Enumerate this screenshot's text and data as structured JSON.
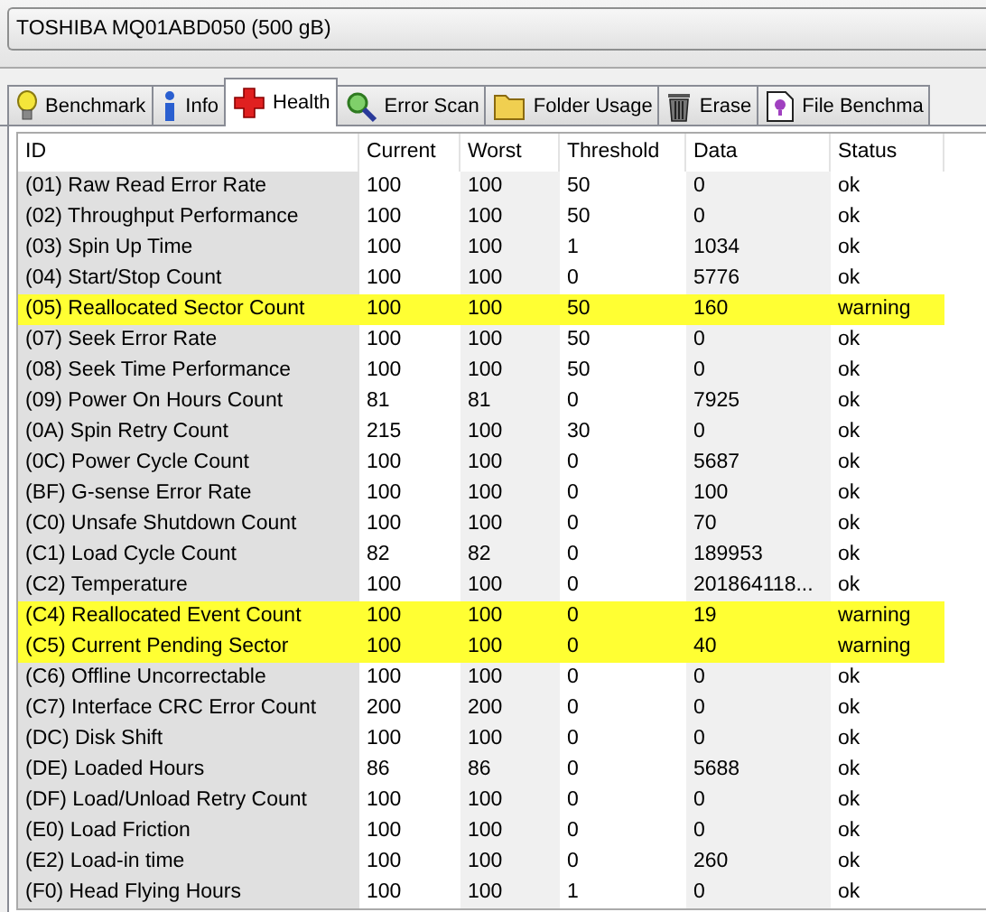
{
  "drive_select": {
    "value": "TOSHIBA MQ01ABD050 (500 gB)"
  },
  "tabs": [
    {
      "label": "Benchmark",
      "selected": false
    },
    {
      "label": "Info",
      "selected": false
    },
    {
      "label": "Health",
      "selected": true
    },
    {
      "label": "Error Scan",
      "selected": false
    },
    {
      "label": "Folder Usage",
      "selected": false
    },
    {
      "label": "Erase",
      "selected": false
    },
    {
      "label": "File Benchma",
      "selected": false
    }
  ],
  "table": {
    "columns": [
      "ID",
      "Current",
      "Worst",
      "Threshold",
      "Data",
      "Status"
    ],
    "rows": [
      {
        "cells": [
          "(01) Raw Read Error Rate",
          "100",
          "100",
          "50",
          "0",
          "ok"
        ],
        "highlighted": false
      },
      {
        "cells": [
          "(02) Throughput Performance",
          "100",
          "100",
          "50",
          "0",
          "ok"
        ],
        "highlighted": false
      },
      {
        "cells": [
          "(03) Spin Up Time",
          "100",
          "100",
          "1",
          "1034",
          "ok"
        ],
        "highlighted": false
      },
      {
        "cells": [
          "(04) Start/Stop Count",
          "100",
          "100",
          "0",
          "5776",
          "ok"
        ],
        "highlighted": false
      },
      {
        "cells": [
          "(05) Reallocated Sector Count",
          "100",
          "100",
          "50",
          "160",
          "warning"
        ],
        "highlighted": true
      },
      {
        "cells": [
          "(07) Seek Error Rate",
          "100",
          "100",
          "50",
          "0",
          "ok"
        ],
        "highlighted": false
      },
      {
        "cells": [
          "(08) Seek Time Performance",
          "100",
          "100",
          "50",
          "0",
          "ok"
        ],
        "highlighted": false
      },
      {
        "cells": [
          "(09) Power On Hours Count",
          "81",
          "81",
          "0",
          "7925",
          "ok"
        ],
        "highlighted": false
      },
      {
        "cells": [
          "(0A) Spin Retry Count",
          "215",
          "100",
          "30",
          "0",
          "ok"
        ],
        "highlighted": false
      },
      {
        "cells": [
          "(0C) Power Cycle Count",
          "100",
          "100",
          "0",
          "5687",
          "ok"
        ],
        "highlighted": false
      },
      {
        "cells": [
          "(BF) G-sense Error Rate",
          "100",
          "100",
          "0",
          "100",
          "ok"
        ],
        "highlighted": false
      },
      {
        "cells": [
          "(C0) Unsafe Shutdown Count",
          "100",
          "100",
          "0",
          "70",
          "ok"
        ],
        "highlighted": false
      },
      {
        "cells": [
          "(C1) Load Cycle Count",
          "82",
          "82",
          "0",
          "189953",
          "ok"
        ],
        "highlighted": false
      },
      {
        "cells": [
          "(C2) Temperature",
          "100",
          "100",
          "0",
          "201864118...",
          "ok"
        ],
        "highlighted": false
      },
      {
        "cells": [
          "(C4) Reallocated Event Count",
          "100",
          "100",
          "0",
          "19",
          "warning"
        ],
        "highlighted": true
      },
      {
        "cells": [
          "(C5) Current Pending Sector",
          "100",
          "100",
          "0",
          "40",
          "warning"
        ],
        "highlighted": true
      },
      {
        "cells": [
          "(C6) Offline Uncorrectable",
          "100",
          "100",
          "0",
          "0",
          "ok"
        ],
        "highlighted": false
      },
      {
        "cells": [
          "(C7) Interface CRC Error Count",
          "200",
          "200",
          "0",
          "0",
          "ok"
        ],
        "highlighted": false
      },
      {
        "cells": [
          "(DC) Disk Shift",
          "100",
          "100",
          "0",
          "0",
          "ok"
        ],
        "highlighted": false
      },
      {
        "cells": [
          "(DE) Loaded Hours",
          "86",
          "86",
          "0",
          "5688",
          "ok"
        ],
        "highlighted": false
      },
      {
        "cells": [
          "(DF) Load/Unload Retry Count",
          "100",
          "100",
          "0",
          "0",
          "ok"
        ],
        "highlighted": false
      },
      {
        "cells": [
          "(E0) Load Friction",
          "100",
          "100",
          "0",
          "0",
          "ok"
        ],
        "highlighted": false
      },
      {
        "cells": [
          "(E2) Load-in time",
          "100",
          "100",
          "0",
          "260",
          "ok"
        ],
        "highlighted": false
      },
      {
        "cells": [
          "(F0) Head Flying Hours",
          "100",
          "100",
          "1",
          "0",
          "ok"
        ],
        "highlighted": false
      }
    ]
  }
}
